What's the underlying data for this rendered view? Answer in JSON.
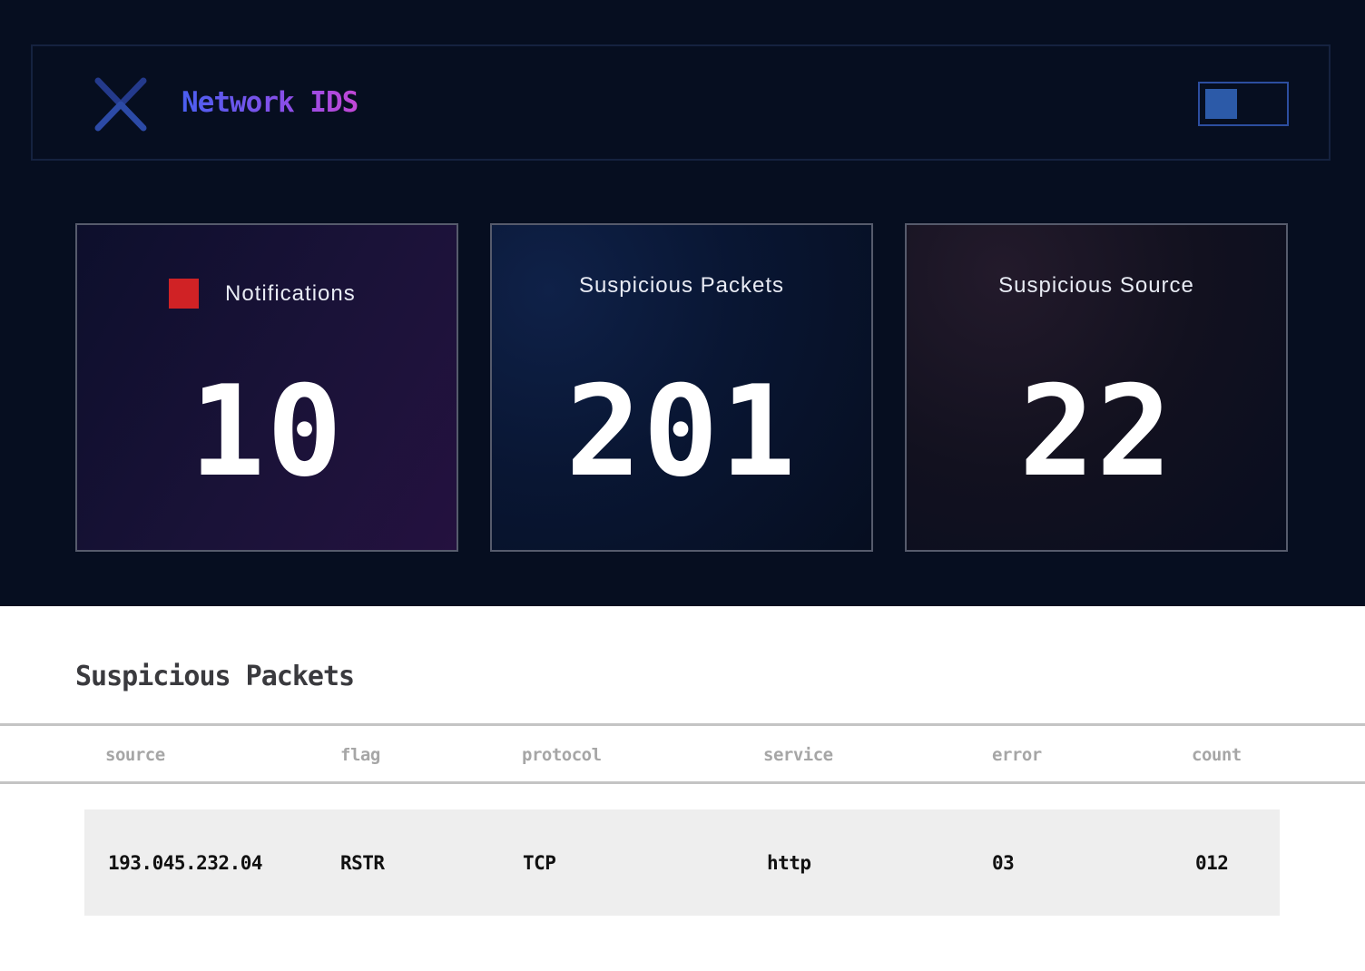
{
  "header": {
    "brand": "Network IDS",
    "logo_icon": "x-logo-icon",
    "accent_gradient": [
      "#4a5ff0",
      "#c347d6"
    ]
  },
  "stats": [
    {
      "label": "Notifications",
      "value": "10",
      "indicator_color": "#d02225"
    },
    {
      "label": "Suspicious Packets",
      "value": "201"
    },
    {
      "label": "Suspicious Source",
      "value": "22"
    }
  ],
  "table": {
    "title": "Suspicious Packets",
    "columns": [
      "source",
      "flag",
      "protocol",
      "service",
      "error",
      "count"
    ],
    "rows": [
      [
        "193.045.232.04",
        "RSTR",
        "TCP",
        "http",
        "03",
        "012"
      ]
    ]
  }
}
